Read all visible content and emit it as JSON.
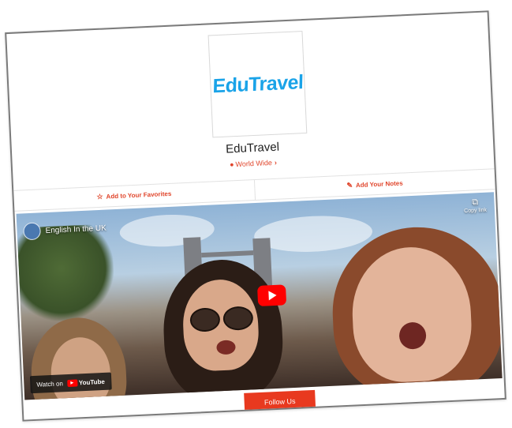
{
  "logo": {
    "text": "EduTravel"
  },
  "brand": {
    "name": "EduTravel"
  },
  "location": {
    "label": "World Wide"
  },
  "actions": {
    "favorites_label": "Add to Your Favorites",
    "notes_label": "Add Your Notes"
  },
  "video": {
    "channel_name": "English In the UK",
    "copy_link_label": "Copy link",
    "watch_on_label": "Watch on",
    "youtube_label": "YouTube"
  },
  "follow": {
    "label": "Follow Us"
  },
  "colors": {
    "accent": "#e0452b",
    "button": "#e8391f",
    "logo": "#1aa3e8",
    "youtube_red": "#ff0000"
  },
  "icons": {
    "location": "map-pin-icon",
    "chevron": "chevron-right-icon",
    "favorites": "star-icon",
    "notes": "edit-icon",
    "copy": "copy-icon",
    "play": "play-icon"
  }
}
